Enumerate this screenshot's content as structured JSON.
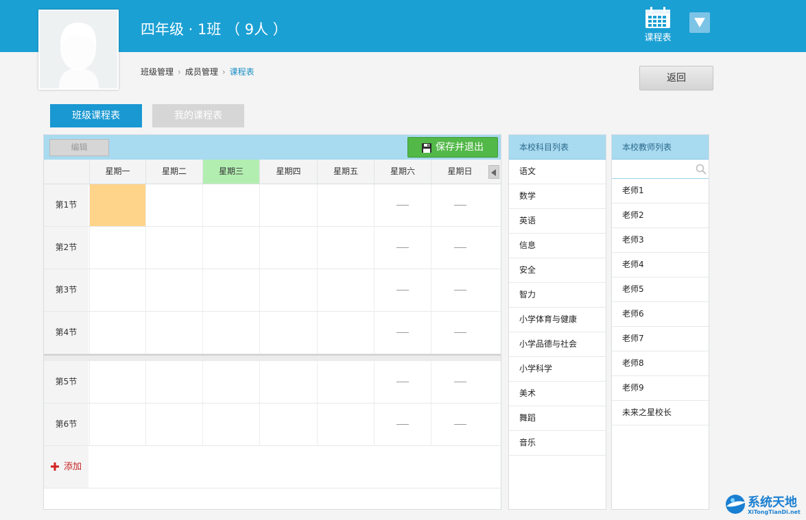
{
  "header": {
    "title": "四年级 · 1班 （ 9人 ）",
    "schedule_label": "课程表",
    "schedule_icon": "calendar-grid-icon",
    "dropdown_icon": "triangle-down-icon",
    "bg_color": "#1ba0d4"
  },
  "breadcrumb": {
    "items": [
      "班级管理",
      "成员管理",
      "课程表"
    ],
    "separator": "›"
  },
  "back_label": "返回",
  "tabs": [
    {
      "label": "班级课程表",
      "active": true
    },
    {
      "label": "我的课程表",
      "active": false
    }
  ],
  "toolbar": {
    "edit_label": "编辑",
    "save_label": "保存并退出",
    "save_icon": "floppy-disk-icon"
  },
  "schedule": {
    "days": [
      "星期一",
      "星期二",
      "星期三",
      "星期四",
      "星期五",
      "星期六",
      "星期日"
    ],
    "today_index": 2,
    "periods": [
      "第1节",
      "第2节",
      "第3节",
      "第4节",
      "第5节",
      "第6节"
    ],
    "add_label": "添加",
    "selected_cell": {
      "period": 0,
      "day": 0
    },
    "empty_day_mark": "—",
    "nav_icon": "triangle-left-icon"
  },
  "subjects": {
    "header": "本校科目列表",
    "items": [
      "语文",
      "数学",
      "英语",
      "信息",
      "安全",
      "智力",
      "小学体育与健康",
      "小学品德与社会",
      "小学科学",
      "美术",
      "舞蹈",
      "音乐"
    ]
  },
  "teachers": {
    "header": "本校教师列表",
    "search_placeholder": "",
    "search_icon": "search-icon",
    "items": [
      "老师1",
      "老师2",
      "老师3",
      "老师4",
      "老师5",
      "老师6",
      "老师7",
      "老师8",
      "老师9",
      "未来之星校长"
    ]
  },
  "watermark": {
    "name": "系统天地",
    "url": "XiTongTianDi.net"
  }
}
